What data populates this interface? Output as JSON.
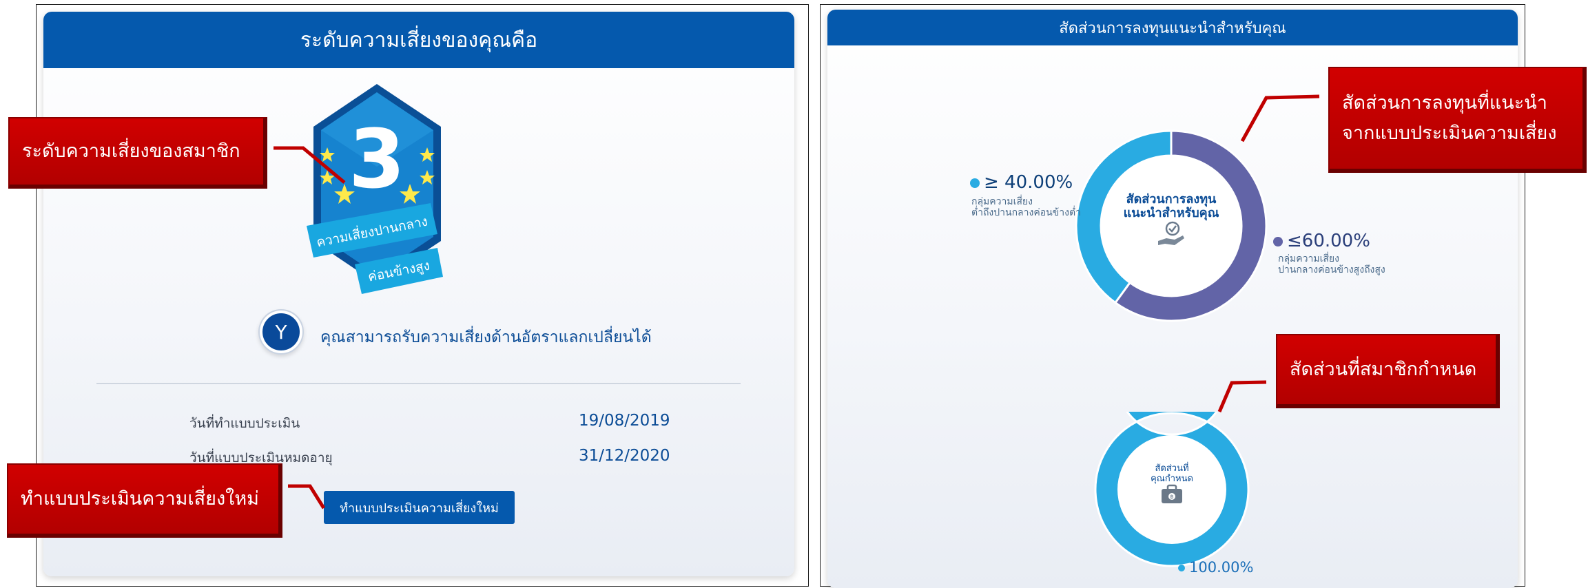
{
  "left_panel": {
    "header": "ระดับความเสี่ยงของคุณคือ",
    "badge": {
      "level": "3",
      "ribbon_line1": "ความเสี่ยงปานกลาง",
      "ribbon_line2": "ค่อนข้างสูง"
    },
    "fx": {
      "icon_letter": "Y",
      "text": "คุณสามารถรับความเสี่ยงด้านอัตราแลกเปลี่ยนได้"
    },
    "info": {
      "assess_date_label": "วันที่ทำแบบประเมิน",
      "assess_date_value": "19/08/2019",
      "expiry_date_label": "วันที่แบบประเมินหมดอายุ",
      "expiry_date_value": "31/12/2020"
    },
    "retake_button": "ทำแบบประเมินความเสี่ยงใหม่"
  },
  "right_panel": {
    "header": "สัดส่วนการลงทุนแนะนำสำหรับคุณ",
    "recommended": {
      "center_line1": "สัดส่วนการลงทุน",
      "center_line2": "แนะนำสำหรับคุณ",
      "low_pct": "≥ 40.00%",
      "low_sub1": "กลุ่มความเสี่ยง",
      "low_sub2": "ต่ำถึงปานกลางค่อนข้างต่ำ",
      "high_pct": "≤60.00%",
      "high_sub1": "กลุ่มความเสี่ยง",
      "high_sub2": "ปานกลางค่อนข้างสูงถึงสูง"
    },
    "member": {
      "center_line1": "สัดส่วนที่",
      "center_line2": "คุณกำหนด",
      "pct": "100.00%"
    }
  },
  "callouts": {
    "member_risk": "ระดับความเสี่ยงของสมาชิก",
    "retake": "ทำแบบประเมินความเสี่ยงใหม่",
    "recommended_line1": "สัดส่วนการลงทุนที่แนะนำ",
    "recommended_line2": "จากแบบประเมินความเสี่ยง",
    "member_set": "สัดส่วนที่สมาชิกกำหนด"
  },
  "chart_data": [
    {
      "type": "pie",
      "categories": [
        "ต่ำถึงปานกลางค่อนข้างต่ำ",
        "ปานกลางค่อนข้างสูงถึงสูง"
      ],
      "values": [
        40,
        60
      ],
      "title": ""
    },
    {
      "type": "pie",
      "categories": [
        "สัดส่วนที่คุณกำหนด"
      ],
      "values": [
        100
      ],
      "title": ""
    }
  ],
  "colors": {
    "header_blue": "#0559ad",
    "donut_light": "#29abe2",
    "donut_purple": "#6264a7",
    "callout_red": "#c00000",
    "text_blue": "#0b4c96"
  }
}
